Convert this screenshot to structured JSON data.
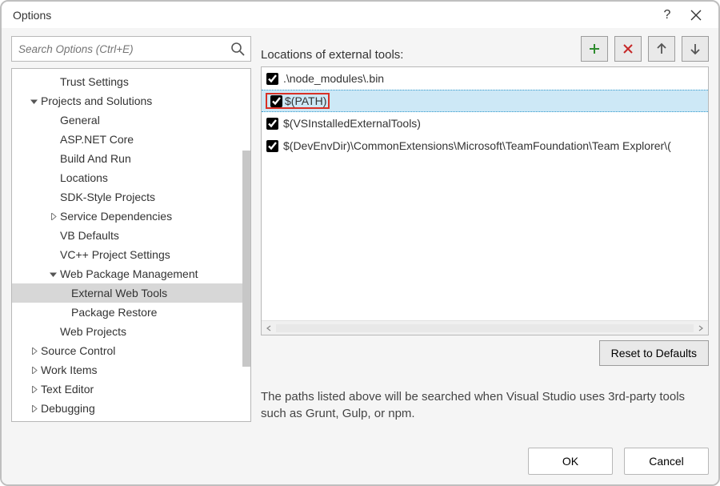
{
  "title": "Options",
  "search": {
    "placeholder": "Search Options (Ctrl+E)"
  },
  "tree": [
    {
      "label": "Trust Settings",
      "level": 2,
      "expander": "none"
    },
    {
      "label": "Projects and Solutions",
      "level": 1,
      "expander": "open"
    },
    {
      "label": "General",
      "level": 2,
      "expander": "none"
    },
    {
      "label": "ASP.NET Core",
      "level": 2,
      "expander": "none"
    },
    {
      "label": "Build And Run",
      "level": 2,
      "expander": "none"
    },
    {
      "label": "Locations",
      "level": 2,
      "expander": "none"
    },
    {
      "label": "SDK-Style Projects",
      "level": 2,
      "expander": "none"
    },
    {
      "label": "Service Dependencies",
      "level": 2,
      "expander": "closed"
    },
    {
      "label": "VB Defaults",
      "level": 2,
      "expander": "none"
    },
    {
      "label": "VC++ Project Settings",
      "level": 2,
      "expander": "none"
    },
    {
      "label": "Web Package Management",
      "level": 2,
      "expander": "open"
    },
    {
      "label": "External Web Tools",
      "level": 3,
      "expander": "none",
      "selected": true
    },
    {
      "label": "Package Restore",
      "level": 3,
      "expander": "none"
    },
    {
      "label": "Web Projects",
      "level": 2,
      "expander": "none"
    },
    {
      "label": "Source Control",
      "level": 1,
      "expander": "closed"
    },
    {
      "label": "Work Items",
      "level": 1,
      "expander": "closed"
    },
    {
      "label": "Text Editor",
      "level": 1,
      "expander": "closed"
    },
    {
      "label": "Debugging",
      "level": 1,
      "expander": "closed"
    }
  ],
  "right": {
    "locations_label": "Locations of external tools:",
    "list": [
      {
        "label": ".\\node_modules\\.bin",
        "checked": true,
        "selected": false
      },
      {
        "label": "$(PATH)",
        "checked": true,
        "selected": true
      },
      {
        "label": "$(VSInstalledExternalTools)",
        "checked": true,
        "selected": false
      },
      {
        "label": "$(DevEnvDir)\\CommonExtensions\\Microsoft\\TeamFoundation\\Team Explorer\\(",
        "checked": true,
        "selected": false
      }
    ],
    "reset_label": "Reset to Defaults",
    "help_text": "The paths listed above will be searched when Visual Studio uses 3rd-party tools such as Grunt, Gulp, or npm."
  },
  "footer": {
    "ok": "OK",
    "cancel": "Cancel"
  }
}
